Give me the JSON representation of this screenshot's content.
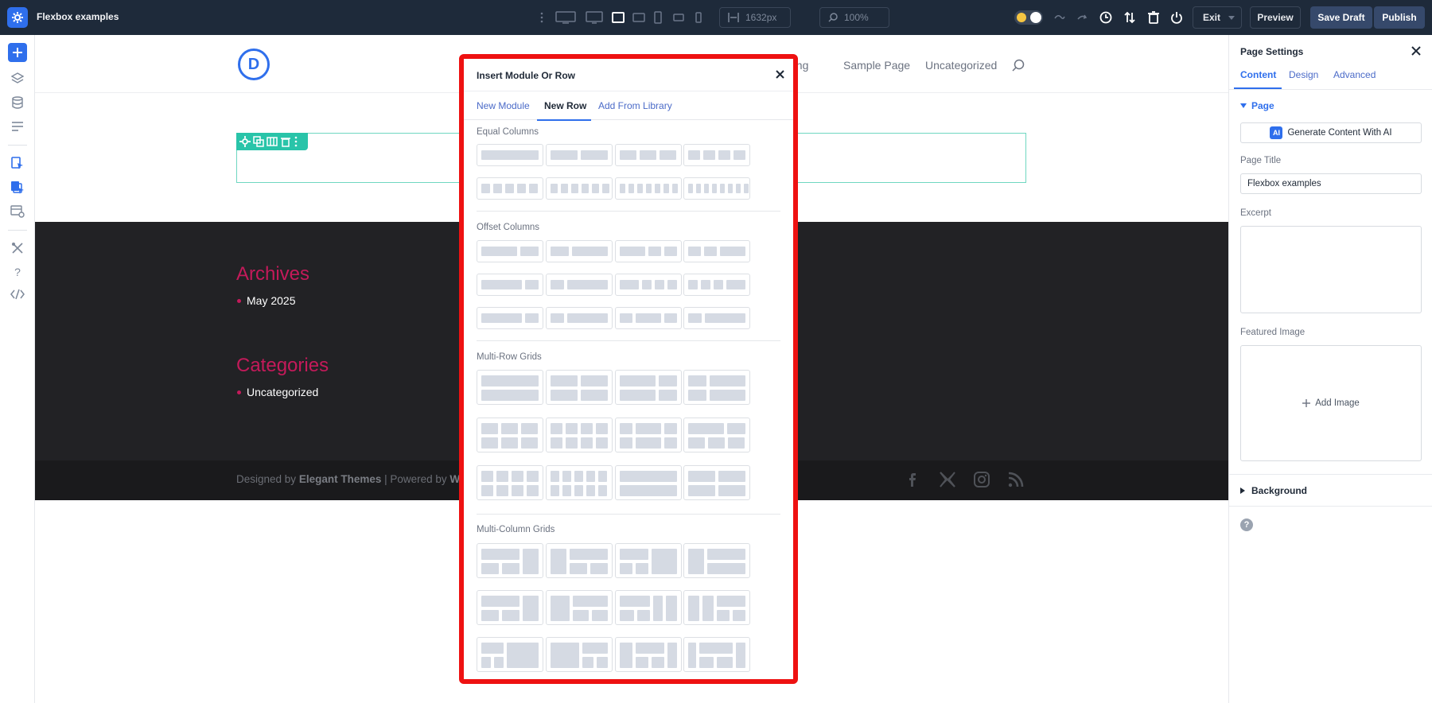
{
  "window": {
    "title": "Flexbox examples"
  },
  "toolbar": {
    "width_value": "1632px",
    "zoom_value": "100%",
    "exit_label": "Exit",
    "preview_label": "Preview",
    "save_draft_label": "Save Draft",
    "publish_label": "Publish"
  },
  "site": {
    "logo_letter": "D",
    "nav": [
      "esting",
      "Sample Page",
      "Uncategorized"
    ],
    "widgets": [
      {
        "heading": "Archives",
        "items": [
          "May 2025"
        ]
      },
      {
        "heading": "Categories",
        "items": [
          "Uncategorized"
        ]
      }
    ],
    "footer": {
      "prefix": "Designed by ",
      "brand": "Elegant Themes",
      "mid": " | Powered by ",
      "tail": "W"
    },
    "social": [
      "facebook-icon",
      "x-icon",
      "instagram-icon",
      "rss-icon"
    ]
  },
  "modal": {
    "title": "Insert Module Or Row",
    "tabs": [
      "New Module",
      "New Row",
      "Add From Library"
    ],
    "active_tab": "New Row",
    "categories": [
      "Equal Columns",
      "Offset Columns",
      "Multi-Row Grids",
      "Multi-Column Grids"
    ]
  },
  "panel": {
    "title": "Page Settings",
    "tabs": [
      "Content",
      "Design",
      "Advanced"
    ],
    "active_tab": "Content",
    "section_page": "Page",
    "ai_button": "Generate Content With AI",
    "ai_badge": "AI",
    "page_title_label": "Page Title",
    "page_title_value": "Flexbox examples",
    "excerpt_label": "Excerpt",
    "excerpt_value": "",
    "featured_label": "Featured Image",
    "add_image": "Add Image",
    "background_label": "Background"
  },
  "colors": {
    "topbar": "#1e2a3a",
    "accent": "#2f6fec",
    "modal_highlight": "#ee1111",
    "row_toolbar": "#29c4a9",
    "widget_heading": "#c41a5a"
  }
}
